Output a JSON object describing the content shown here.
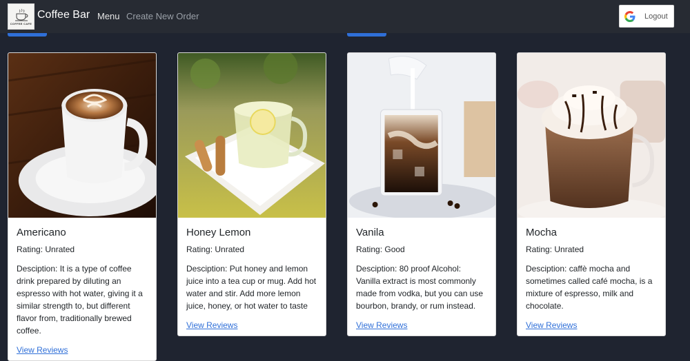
{
  "navbar": {
    "brand_name": "Coffee Bar",
    "logo_text": "COFFEE CAFE",
    "menu_label": "Menu",
    "create_order_label": "Create New Order",
    "logout_label": "Logout",
    "logout_icon": "google-g-icon"
  },
  "colors": {
    "page_bg": "#1f2430",
    "navbar_bg": "#272b33",
    "accent": "#2f6fd8",
    "link": "#2f6fd8"
  },
  "cards": [
    {
      "name": "Americano",
      "rating": "Rating: Unrated",
      "description": "Desciption: It is a type of coffee drink prepared by diluting an espresso with hot water, giving it a similar strength to, but different flavor from, traditionally brewed coffee.",
      "reviews_label": "View Reviews",
      "image": "americano-latte-art-photo"
    },
    {
      "name": "Honey Lemon",
      "rating": "Rating: Unrated",
      "description": "Desciption: Put honey and lemon juice into a tea cup or mug. Add hot water and stir. Add more lemon juice, honey, or hot water to taste",
      "reviews_label": "View Reviews",
      "image": "honey-lemon-tea-photo"
    },
    {
      "name": "Vanila",
      "rating": "Rating: Good",
      "description": "Desciption: 80 proof Alcohol: Vanilla extract is most commonly made from vodka, but you can use bourbon, brandy, or rum instead.",
      "reviews_label": "View Reviews",
      "image": "iced-vanilla-coffee-photo"
    },
    {
      "name": "Mocha",
      "rating": "Rating: Unrated",
      "description": "Desciption: caffè mocha and sometimes called café mocha, is a mixture of espresso, milk and chocolate.",
      "reviews_label": "View Reviews",
      "image": "mocha-whipped-cream-photo"
    }
  ]
}
